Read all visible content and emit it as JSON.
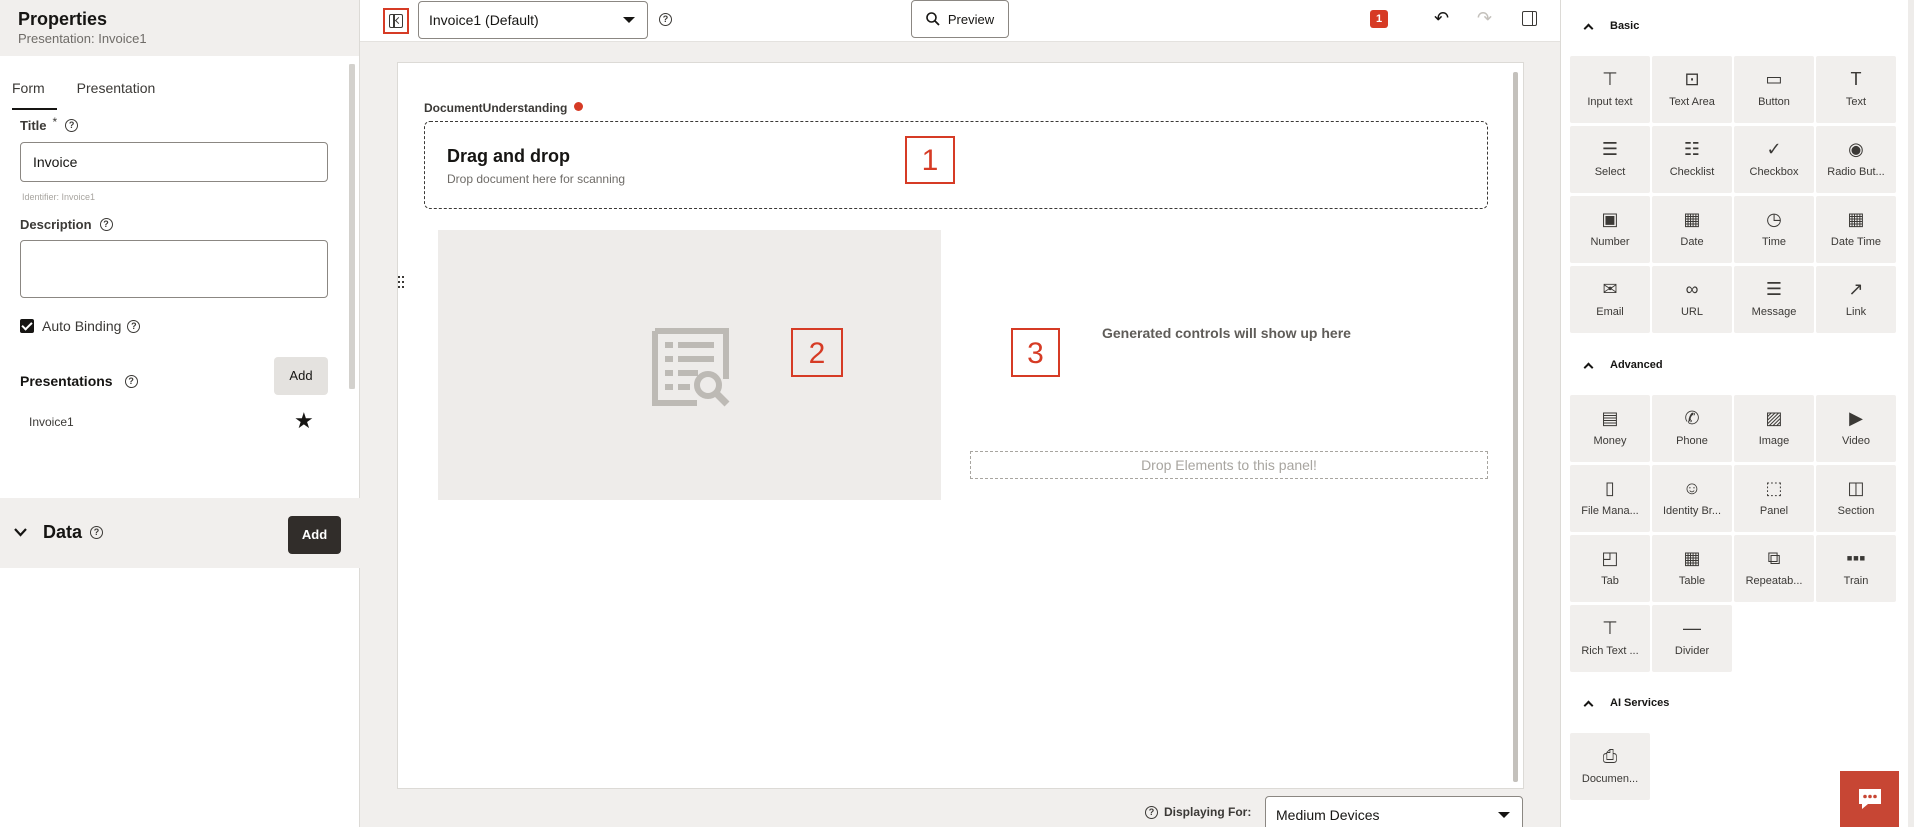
{
  "left_panel": {
    "title": "Properties",
    "subtitle": "Presentation: Invoice1",
    "tabs": [
      {
        "label": "Form"
      },
      {
        "label": "Presentation"
      }
    ],
    "title_field": {
      "label": "Title",
      "required_mark": "*",
      "value": "Invoice",
      "identifier": "Identifier: Invoice1"
    },
    "description_field": {
      "label": "Description",
      "value": ""
    },
    "auto_binding": {
      "label": "Auto Binding",
      "checked": true
    },
    "presentations": {
      "label": "Presentations",
      "add_label": "Add",
      "items": [
        {
          "label": "Invoice1"
        }
      ]
    },
    "data": {
      "label": "Data",
      "add_label": "Add"
    }
  },
  "toolbar": {
    "presentation_select": "Invoice1 (Default)",
    "preview_label": "Preview",
    "error_count": "1"
  },
  "canvas": {
    "component_label": "DocumentUnderstanding",
    "dropzone_title": "Drag and drop",
    "dropzone_subtitle": "Drop document here for scanning",
    "generated_text": "Generated controls will show up here",
    "drop_panel_text": "Drop Elements to this panel!",
    "displaying_for_label": "Displaying For:",
    "device_select": "Medium Devices",
    "markers": [
      "1",
      "2",
      "3"
    ]
  },
  "palette": {
    "sections": [
      {
        "title": "Basic",
        "items": [
          {
            "label": "Input text",
            "icon": "input-text-icon"
          },
          {
            "label": "Text Area",
            "icon": "text-area-icon"
          },
          {
            "label": "Button",
            "icon": "button-icon"
          },
          {
            "label": "Text",
            "icon": "text-icon"
          },
          {
            "label": "Select",
            "icon": "select-icon"
          },
          {
            "label": "Checklist",
            "icon": "checklist-icon"
          },
          {
            "label": "Checkbox",
            "icon": "checkbox-icon"
          },
          {
            "label": "Radio But...",
            "icon": "radio-button-icon"
          },
          {
            "label": "Number",
            "icon": "number-icon"
          },
          {
            "label": "Date",
            "icon": "date-icon"
          },
          {
            "label": "Time",
            "icon": "time-icon"
          },
          {
            "label": "Date Time",
            "icon": "date-time-icon"
          },
          {
            "label": "Email",
            "icon": "email-icon"
          },
          {
            "label": "URL",
            "icon": "url-icon"
          },
          {
            "label": "Message",
            "icon": "message-icon"
          },
          {
            "label": "Link",
            "icon": "link-icon"
          }
        ]
      },
      {
        "title": "Advanced",
        "items": [
          {
            "label": "Money",
            "icon": "money-icon"
          },
          {
            "label": "Phone",
            "icon": "phone-icon"
          },
          {
            "label": "Image",
            "icon": "image-icon"
          },
          {
            "label": "Video",
            "icon": "video-icon"
          },
          {
            "label": "File Mana...",
            "icon": "file-manager-icon"
          },
          {
            "label": "Identity Br...",
            "icon": "identity-browser-icon"
          },
          {
            "label": "Panel",
            "icon": "panel-icon"
          },
          {
            "label": "Section",
            "icon": "section-icon"
          },
          {
            "label": "Tab",
            "icon": "tab-icon"
          },
          {
            "label": "Table",
            "icon": "table-icon"
          },
          {
            "label": "Repeatab...",
            "icon": "repeatable-icon"
          },
          {
            "label": "Train",
            "icon": "train-icon"
          },
          {
            "label": "Rich Text ...",
            "icon": "rich-text-icon"
          },
          {
            "label": "Divider",
            "icon": "divider-icon"
          }
        ]
      },
      {
        "title": "AI Services",
        "items": [
          {
            "label": "Documen...",
            "icon": "document-understanding-icon"
          }
        ]
      }
    ]
  },
  "colors": {
    "accent_red": "#d63b25",
    "dark_button": "#312d2a",
    "chat_button": "#c74634"
  }
}
